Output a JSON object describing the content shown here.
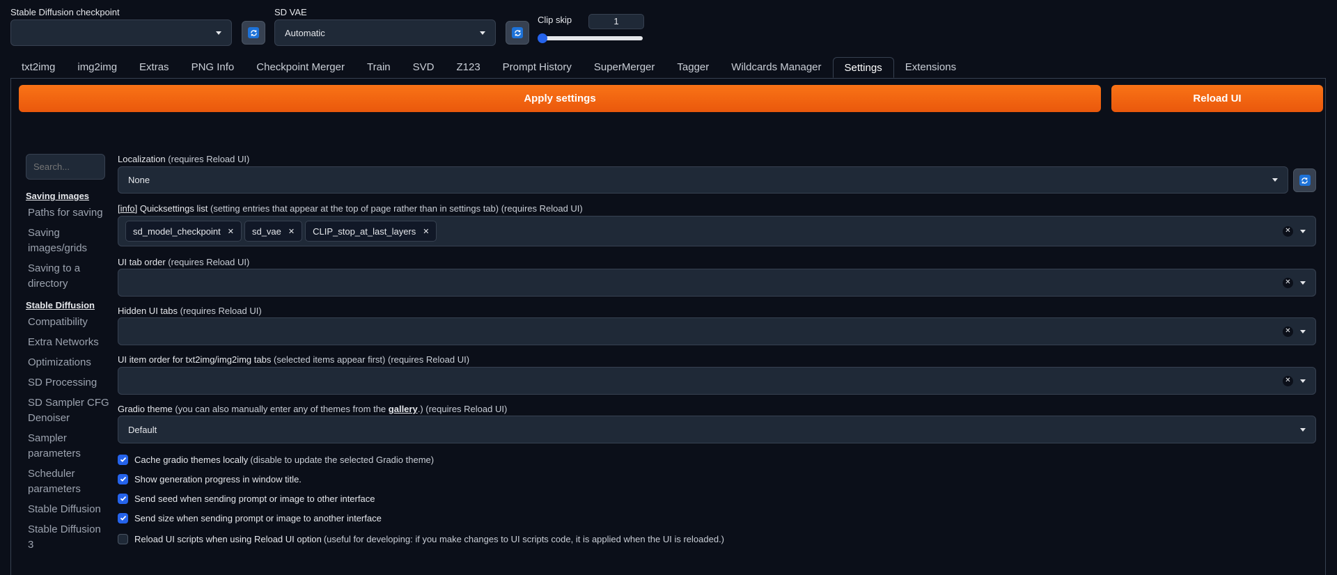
{
  "top": {
    "checkpoint": {
      "label": "Stable Diffusion checkpoint",
      "value": ""
    },
    "vae": {
      "label": "SD VAE",
      "value": "Automatic"
    },
    "clip_skip": {
      "label": "Clip skip",
      "value": "1",
      "slider_level": 0
    }
  },
  "tabs": [
    "txt2img",
    "img2img",
    "Extras",
    "PNG Info",
    "Checkpoint Merger",
    "Train",
    "SVD",
    "Z123",
    "Prompt History",
    "SuperMerger",
    "Tagger",
    "Wildcards Manager",
    "Settings",
    "Extensions"
  ],
  "active_tab": "Settings",
  "buttons": {
    "apply": "Apply settings",
    "reload": "Reload UI"
  },
  "sidebar": {
    "search_placeholder": "Search...",
    "sections": [
      {
        "head": "Saving images",
        "items": [
          "Paths for saving",
          "Saving images/grids",
          "Saving to a directory"
        ]
      },
      {
        "head": "Stable Diffusion",
        "items": [
          "Compatibility",
          "Extra Networks",
          "Optimizations",
          "SD Processing",
          "SD Sampler CFG Denoiser",
          "Sampler parameters",
          "Scheduler parameters",
          "Stable Diffusion",
          "Stable Diffusion 3"
        ]
      }
    ]
  },
  "settings": {
    "localization": {
      "label": "Localization",
      "note": "(requires Reload UI)",
      "value": "None"
    },
    "quicksettings": {
      "info": "info",
      "label": "Quicksettings list",
      "note": "(setting entries that appear at the top of page rather than in settings tab) (requires Reload UI)",
      "chips": [
        "sd_model_checkpoint",
        "sd_vae",
        "CLIP_stop_at_last_layers"
      ]
    },
    "tab_order": {
      "label": "UI tab order",
      "note": "(requires Reload UI)"
    },
    "hidden_tabs": {
      "label": "Hidden UI tabs",
      "note": "(requires Reload UI)"
    },
    "item_order": {
      "label": "UI item order for txt2img/img2img tabs",
      "note": "(selected items appear first) (requires Reload UI)"
    },
    "gradio_theme": {
      "label": "Gradio theme",
      "note_pre": "(you can also manually enter any of themes from the",
      "link": "gallery",
      "note_post": ".) (requires Reload UI)",
      "value": "Default"
    },
    "checkboxes": [
      {
        "label": "Cache gradio themes locally",
        "note": "(disable to update the selected Gradio theme)",
        "checked": true
      },
      {
        "label": "Show generation progress in window title.",
        "note": "",
        "checked": true
      },
      {
        "label": "Send seed when sending prompt or image to other interface",
        "note": "",
        "checked": true
      },
      {
        "label": "Send size when sending prompt or image to another interface",
        "note": "",
        "checked": true
      },
      {
        "label": "Reload UI scripts when using Reload UI option",
        "note": "(useful for developing: if you make changes to UI scripts code, it is applied when the UI is reloaded.)",
        "checked": false
      }
    ]
  },
  "colors": {
    "accent": "#f97316",
    "checkbox": "#2563eb",
    "refresh": "#1d72d8",
    "background": "#0b0f19",
    "field": "#1f2937"
  }
}
